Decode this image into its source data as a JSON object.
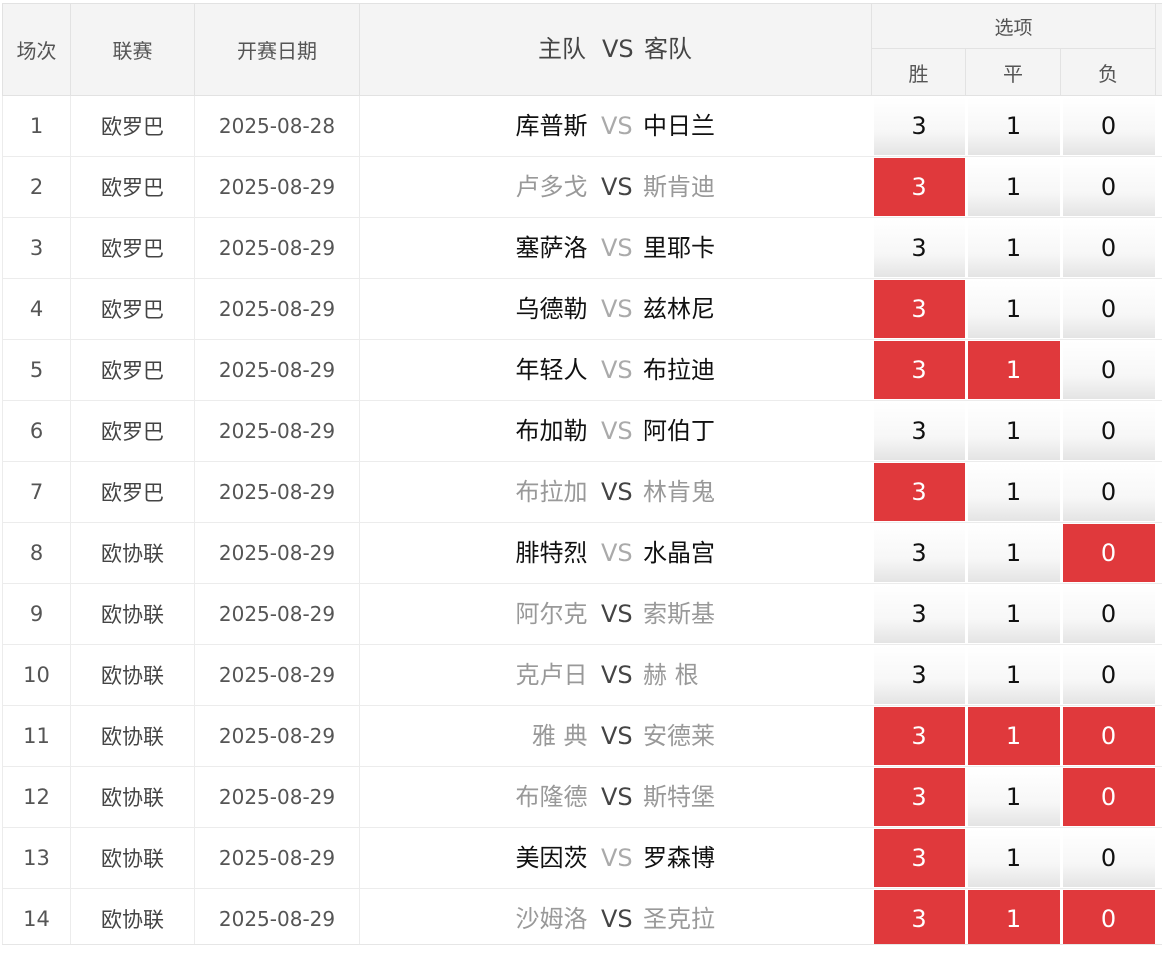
{
  "header": {
    "seq": "场次",
    "league": "联赛",
    "date": "开赛日期",
    "home": "主队",
    "vs": "VS",
    "away": "客队",
    "options": "选项",
    "win": "胜",
    "draw": "平",
    "lose": "负"
  },
  "colors": {
    "selected": "#e0393c",
    "header_bg": "#f4f4f4"
  },
  "rows": [
    {
      "seq": "1",
      "league": "欧罗巴",
      "date": "2025-08-28",
      "home": "库普斯",
      "vs": "VS",
      "away": "中日兰",
      "win": "3",
      "draw": "1",
      "lose": "0",
      "sel": [
        false,
        false,
        false
      ],
      "muted": false
    },
    {
      "seq": "2",
      "league": "欧罗巴",
      "date": "2025-08-29",
      "home": "卢多戈",
      "vs": "VS",
      "away": "斯肯迪",
      "win": "3",
      "draw": "1",
      "lose": "0",
      "sel": [
        true,
        false,
        false
      ],
      "muted": true
    },
    {
      "seq": "3",
      "league": "欧罗巴",
      "date": "2025-08-29",
      "home": "塞萨洛",
      "vs": "VS",
      "away": "里耶卡",
      "win": "3",
      "draw": "1",
      "lose": "0",
      "sel": [
        false,
        false,
        false
      ],
      "muted": false
    },
    {
      "seq": "4",
      "league": "欧罗巴",
      "date": "2025-08-29",
      "home": "乌德勒",
      "vs": "VS",
      "away": "兹林尼",
      "win": "3",
      "draw": "1",
      "lose": "0",
      "sel": [
        true,
        false,
        false
      ],
      "muted": false
    },
    {
      "seq": "5",
      "league": "欧罗巴",
      "date": "2025-08-29",
      "home": "年轻人",
      "vs": "VS",
      "away": "布拉迪",
      "win": "3",
      "draw": "1",
      "lose": "0",
      "sel": [
        true,
        true,
        false
      ],
      "muted": false
    },
    {
      "seq": "6",
      "league": "欧罗巴",
      "date": "2025-08-29",
      "home": "布加勒",
      "vs": "VS",
      "away": "阿伯丁",
      "win": "3",
      "draw": "1",
      "lose": "0",
      "sel": [
        false,
        false,
        false
      ],
      "muted": false
    },
    {
      "seq": "7",
      "league": "欧罗巴",
      "date": "2025-08-29",
      "home": "布拉加",
      "vs": "VS",
      "away": "林肯鬼",
      "win": "3",
      "draw": "1",
      "lose": "0",
      "sel": [
        true,
        false,
        false
      ],
      "muted": true
    },
    {
      "seq": "8",
      "league": "欧协联",
      "date": "2025-08-29",
      "home": "腓特烈",
      "vs": "VS",
      "away": "水晶宫",
      "win": "3",
      "draw": "1",
      "lose": "0",
      "sel": [
        false,
        false,
        true
      ],
      "muted": false
    },
    {
      "seq": "9",
      "league": "欧协联",
      "date": "2025-08-29",
      "home": "阿尔克",
      "vs": "VS",
      "away": "索斯基",
      "win": "3",
      "draw": "1",
      "lose": "0",
      "sel": [
        false,
        false,
        false
      ],
      "muted": true
    },
    {
      "seq": "10",
      "league": "欧协联",
      "date": "2025-08-29",
      "home": "克卢日",
      "vs": "VS",
      "away": "赫 根",
      "win": "3",
      "draw": "1",
      "lose": "0",
      "sel": [
        false,
        false,
        false
      ],
      "muted": true
    },
    {
      "seq": "11",
      "league": "欧协联",
      "date": "2025-08-29",
      "home": "雅 典",
      "vs": "VS",
      "away": "安德莱",
      "win": "3",
      "draw": "1",
      "lose": "0",
      "sel": [
        true,
        true,
        true
      ],
      "muted": true
    },
    {
      "seq": "12",
      "league": "欧协联",
      "date": "2025-08-29",
      "home": "布隆德",
      "vs": "VS",
      "away": "斯特堡",
      "win": "3",
      "draw": "1",
      "lose": "0",
      "sel": [
        true,
        false,
        true
      ],
      "muted": true
    },
    {
      "seq": "13",
      "league": "欧协联",
      "date": "2025-08-29",
      "home": "美因茨",
      "vs": "VS",
      "away": "罗森博",
      "win": "3",
      "draw": "1",
      "lose": "0",
      "sel": [
        true,
        false,
        false
      ],
      "muted": false
    },
    {
      "seq": "14",
      "league": "欧协联",
      "date": "2025-08-29",
      "home": "沙姆洛",
      "vs": "VS",
      "away": "圣克拉",
      "win": "3",
      "draw": "1",
      "lose": "0",
      "sel": [
        true,
        true,
        true
      ],
      "muted": true
    }
  ]
}
